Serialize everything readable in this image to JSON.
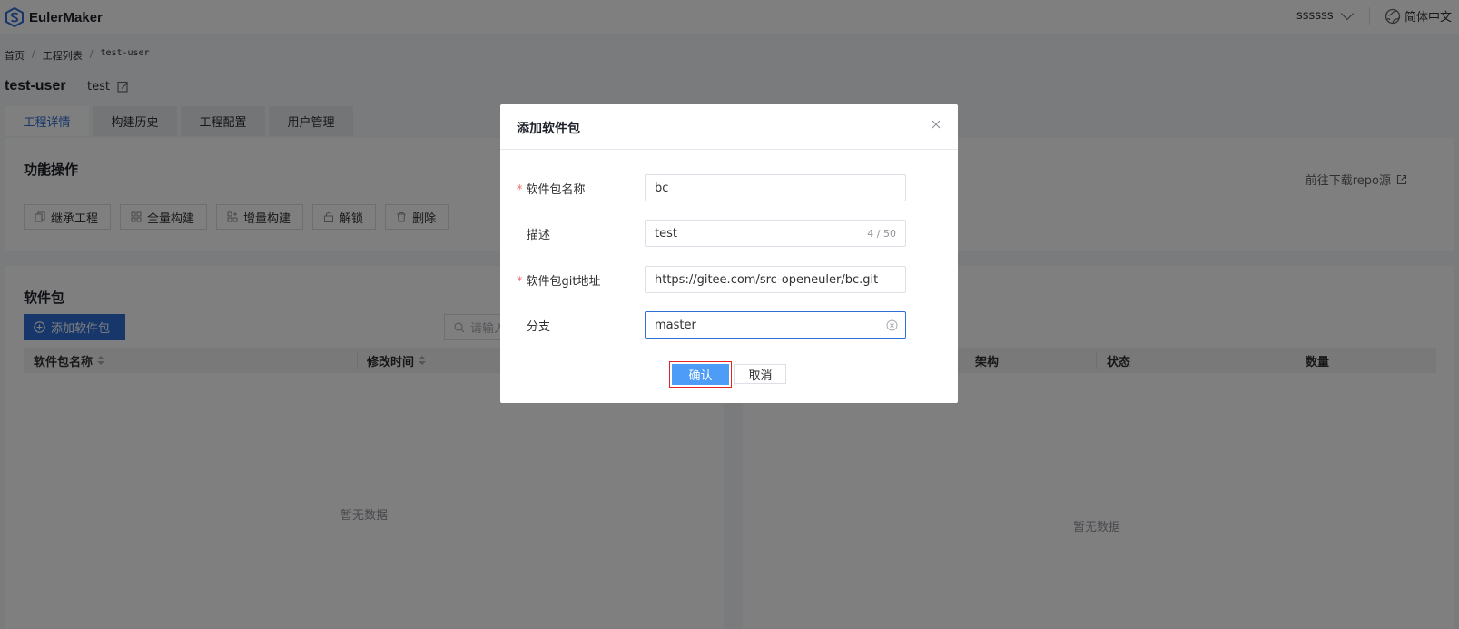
{
  "header": {
    "logo_text": "EulerMaker",
    "username": "ssssss",
    "language": "简体中文"
  },
  "breadcrumb": {
    "home": "首页",
    "projects": "工程列表",
    "current": "test-user"
  },
  "project": {
    "name": "test-user",
    "description": "test"
  },
  "tabs": [
    {
      "label": "工程详情",
      "active": true
    },
    {
      "label": "构建历史",
      "active": false
    },
    {
      "label": "工程配置",
      "active": false
    },
    {
      "label": "用户管理",
      "active": false
    }
  ],
  "functions": {
    "title": "功能操作",
    "buttons": [
      "继承工程",
      "全量构建",
      "增量构建",
      "解锁",
      "删除"
    ],
    "repo_link": "前往下载repo源"
  },
  "packages": {
    "title": "软件包",
    "add_button": "添加软件包",
    "search_placeholder": "请输入",
    "columns": [
      "软件包名称",
      "修改时间"
    ],
    "empty_text": "暂无数据"
  },
  "right_table": {
    "columns": [
      "架构",
      "状态",
      "数量"
    ],
    "empty_text": "暂无数据"
  },
  "dialog": {
    "title": "添加软件包",
    "fields": {
      "name": {
        "label": "软件包名称",
        "value": "bc",
        "required": true
      },
      "description": {
        "label": "描述",
        "value": "test",
        "counter": "4 / 50",
        "required": false
      },
      "git_url": {
        "label": "软件包git地址",
        "value": "https://gitee.com/src-openeuler/bc.git",
        "required": true
      },
      "branch": {
        "label": "分支",
        "value": "master",
        "required": false
      }
    },
    "confirm_label": "确认",
    "cancel_label": "取消"
  },
  "colors": {
    "primary": "#2f6fd6",
    "confirm": "#4d9cf7",
    "highlight_border": "#e02424",
    "required_mark": "#f56c6c"
  }
}
